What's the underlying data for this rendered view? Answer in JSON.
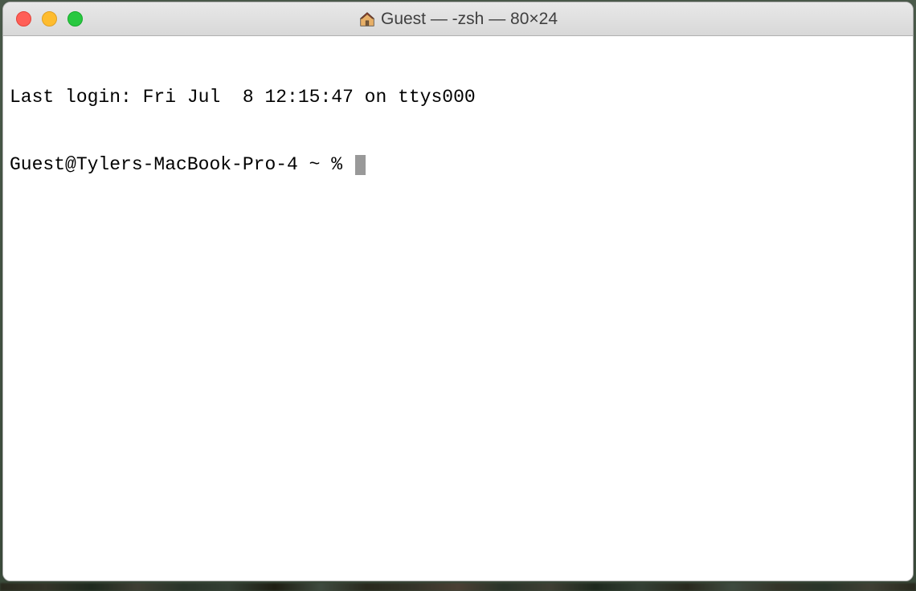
{
  "window": {
    "title": "Guest — -zsh — 80×24",
    "icon_name": "home-icon"
  },
  "terminal": {
    "last_login_line": "Last login: Fri Jul  8 12:15:47 on ttys000",
    "prompt": "Guest@Tylers-MacBook-Pro-4 ~ % "
  }
}
